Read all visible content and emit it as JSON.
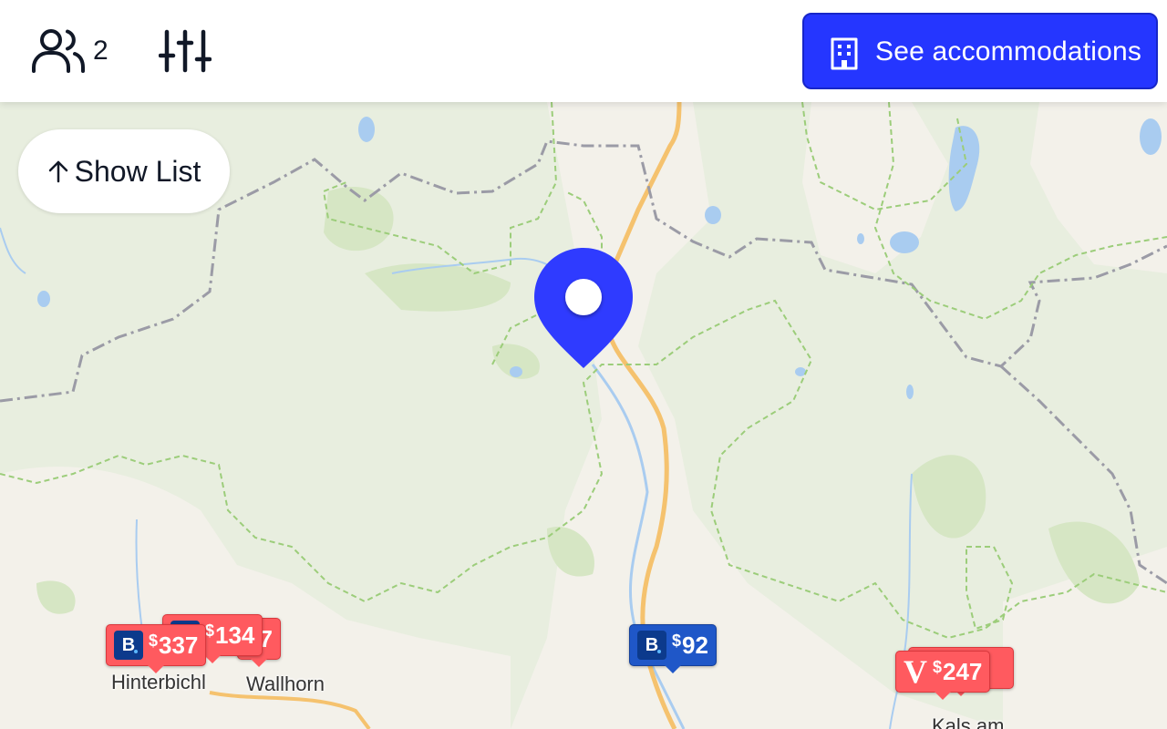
{
  "header": {
    "guests": {
      "icon": "users-icon",
      "count": "2"
    },
    "filters": {
      "icon": "sliders-icon"
    },
    "cta": {
      "icon": "building-icon",
      "label": "See accommodations",
      "color": "#2536ff"
    }
  },
  "map": {
    "show_list": {
      "icon": "arrow-up-icon",
      "label": "Show List"
    },
    "selected_pin": {
      "icon": "map-pin-icon",
      "color": "#2f3bff"
    },
    "markers": [
      {
        "provider": "booking",
        "icon": "booking-logo-icon",
        "price": "337",
        "currency": "$",
        "color": "#ff5a5f"
      },
      {
        "provider": "booking",
        "icon": "booking-logo-icon",
        "price": "134",
        "currency": "$",
        "color": "#ff5a5f"
      },
      {
        "provider": "booking",
        "icon": "booking-logo-icon",
        "price": "47",
        "currency": "",
        "color": "#ff5a5f"
      },
      {
        "provider": "booking",
        "icon": "booking-logo-icon",
        "price": "92",
        "currency": "$",
        "color": "#1f57c8"
      },
      {
        "provider": "vrbo",
        "icon": "vrbo-logo-icon",
        "price": "247",
        "currency": "$",
        "color": "#ff5a5f"
      }
    ],
    "places": [
      "Hinterbichl",
      "Wallhorn",
      "Kals am"
    ]
  }
}
